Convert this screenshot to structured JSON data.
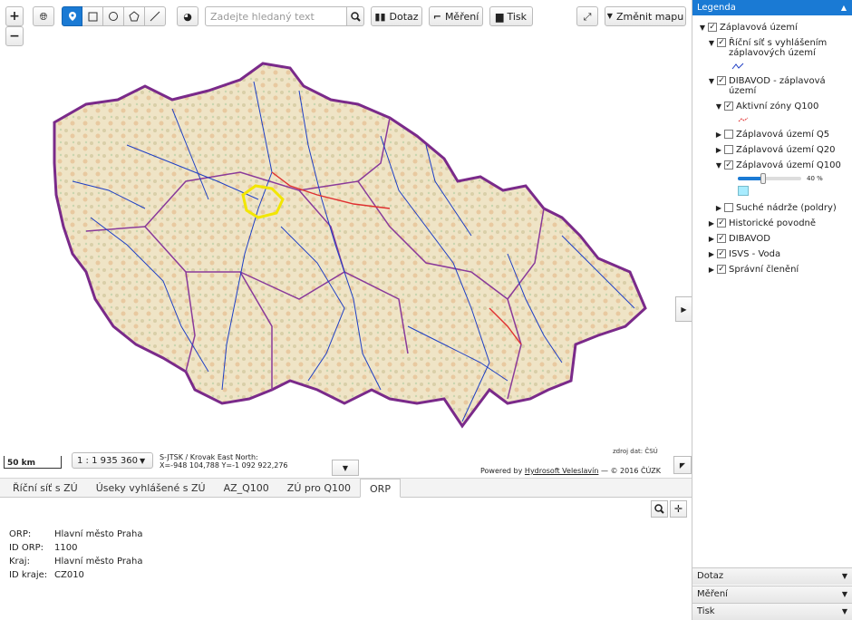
{
  "toolbar": {
    "zoom_in": "+",
    "zoom_out": "−",
    "search_placeholder": "Zadejte hledaný text",
    "query_label": "Dotaz",
    "measure_label": "Měření",
    "print_label": "Tisk",
    "change_map_label": "Změnit mapu"
  },
  "map": {
    "scale_bar": "50 km",
    "scale_ratio": "1 : 1 935 360",
    "projection_line1": "S-JTSK / Krovak East North:",
    "projection_line2": "X=-948 104,788 Y=-1 092 922,276",
    "data_source": "zdroj dat: ČSÚ",
    "powered_prefix": "Powered by ",
    "powered_link": "Hydrosoft Veleslavín",
    "powered_suffix": " — © 2016 ČÚZK",
    "colors": {
      "border": "#7a2a8a",
      "river": "#1f3fc4",
      "highlight": "#f2e600",
      "q100": "#e03030"
    }
  },
  "bottom_tabs": [
    {
      "label": "Říční síť s ZÚ"
    },
    {
      "label": "Úseky vyhlášené s ZÚ"
    },
    {
      "label": "AZ_Q100"
    },
    {
      "label": "ZÚ pro Q100"
    },
    {
      "label": "ORP"
    }
  ],
  "info": {
    "rows": [
      {
        "key": "ORP:",
        "value": "Hlavní město Praha"
      },
      {
        "key": "ID ORP:",
        "value": "1100"
      },
      {
        "key": "Kraj:",
        "value": "Hlavní město Praha"
      },
      {
        "key": "ID kraje:",
        "value": "CZ010"
      }
    ]
  },
  "legend": {
    "title": "Legenda",
    "items": [
      {
        "label": "Záplavová území"
      },
      {
        "label": "Říční síť s vyhlášením záplavových území"
      },
      {
        "label": "DIBAVOD - záplavová území"
      },
      {
        "label": "Aktivní zóny Q100"
      },
      {
        "label": "Záplavová území Q5"
      },
      {
        "label": "Záplavová území Q20"
      },
      {
        "label": "Záplavová území Q100"
      },
      {
        "label": "Suché nádrže (poldry)"
      },
      {
        "label": "Historické povodně"
      },
      {
        "label": "DIBAVOD"
      },
      {
        "label": "ISVS - Voda"
      },
      {
        "label": "Správní členění"
      }
    ],
    "opacity_value": 0.4,
    "opacity_label": "40 %",
    "q100_swatch": "#a8ecff"
  },
  "accordions": [
    {
      "label": "Dotaz"
    },
    {
      "label": "Měření"
    },
    {
      "label": "Tisk"
    }
  ]
}
